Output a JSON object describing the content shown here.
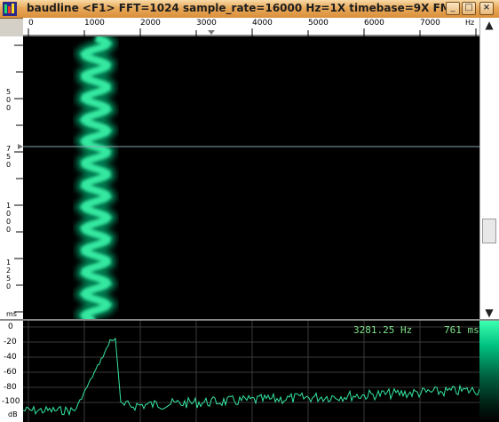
{
  "window": {
    "title": "baudline  <F1> FFT=1024 sample_rate=16000 Hz=1X timebase=9X  FM",
    "buttons": [
      "_",
      "□",
      "×"
    ]
  },
  "freq_ruler": {
    "ticks": [
      "0",
      "1000",
      "2000",
      "3000",
      "4000",
      "5000",
      "6000",
      "7000"
    ],
    "unit": "Hz"
  },
  "time_ruler": {
    "labels": [
      "500",
      "750",
      "1000",
      "1250"
    ],
    "unit": "ms"
  },
  "readout": {
    "frequency": "3281.25 Hz",
    "time": "761 ms"
  },
  "db_axis": {
    "labels": [
      "0",
      "-20",
      "-40",
      "-60",
      "-80",
      "-100"
    ],
    "unit": "dB"
  },
  "scrollbar": {
    "up_icon": "triangle-up-icon",
    "down_icon": "triangle-down-icon"
  },
  "colors": {
    "trace": "#35e8a0",
    "spectrogram_high": "#3cffb0",
    "spectrogram_mid": "#007a50",
    "background": "#000000",
    "titlebar": "#e8a95a"
  }
}
